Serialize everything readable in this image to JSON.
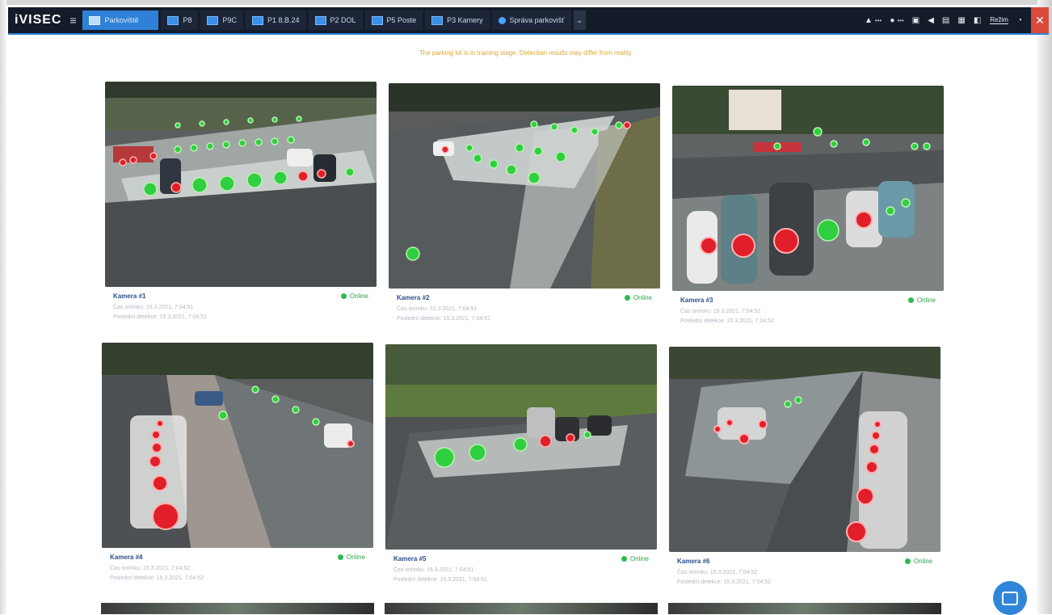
{
  "app": {
    "logo": "iVISEC",
    "menu_icon": "hamburger-icon"
  },
  "nav": {
    "tabs": [
      {
        "label": "Parkoviště",
        "active": true
      },
      {
        "label": "P8"
      },
      {
        "label": "P9C"
      },
      {
        "label": "P1 8.B.24"
      },
      {
        "label": "P2 DOL"
      },
      {
        "label": "P5 Poste"
      },
      {
        "label": "P3 Kamery"
      },
      {
        "label": "Správa parkovišť",
        "round": true
      }
    ],
    "dropdown_icon": "chevron-down-icon"
  },
  "toolbar": {
    "alerts_label": "•••",
    "user_label": "•••",
    "mode_label": "Režim",
    "close_icon": "close-icon"
  },
  "warning": "The parking lot is in training stage. Detection results may differ from reality.",
  "cameras": [
    {
      "name": "Kamera #1",
      "status": "Online",
      "snapshot": "Čas snímku: 15.3.2021, 7:04:51",
      "last": "Poslední detekce: 15.3.2021, 7:04:51"
    },
    {
      "name": "Kamera #2",
      "status": "Online",
      "snapshot": "Čas snímku: 15.3.2021, 7:04:51",
      "last": "Poslední detekce: 15.3.2021, 7:04:51"
    },
    {
      "name": "Kamera #3",
      "status": "Online",
      "snapshot": "Čas snímku: 15.3.2021, 7:04:52",
      "last": "Poslední detekce: 15.3.2021, 7:04:52"
    },
    {
      "name": "Kamera #4",
      "status": "Online",
      "snapshot": "Čas snímku: 15.3.2021, 7:04:52",
      "last": "Poslední detekce: 15.3.2021, 7:04:52"
    },
    {
      "name": "Kamera #5",
      "status": "Online",
      "snapshot": "Čas snímku: 15.3.2021, 7:04:51",
      "last": "Poslední detekce: 15.3.2021, 7:04:51"
    },
    {
      "name": "Kamera #6",
      "status": "Online",
      "snapshot": "Čas snímku: 15.3.2021, 7:04:52",
      "last": "Poslední detekce: 15.3.2021, 7:04:52"
    }
  ],
  "colors": {
    "accent": "#2f80d7",
    "online": "#2dbb52",
    "occupied": "#e01f2a",
    "free": "#3fc43f",
    "warning": "#e0a82e"
  }
}
